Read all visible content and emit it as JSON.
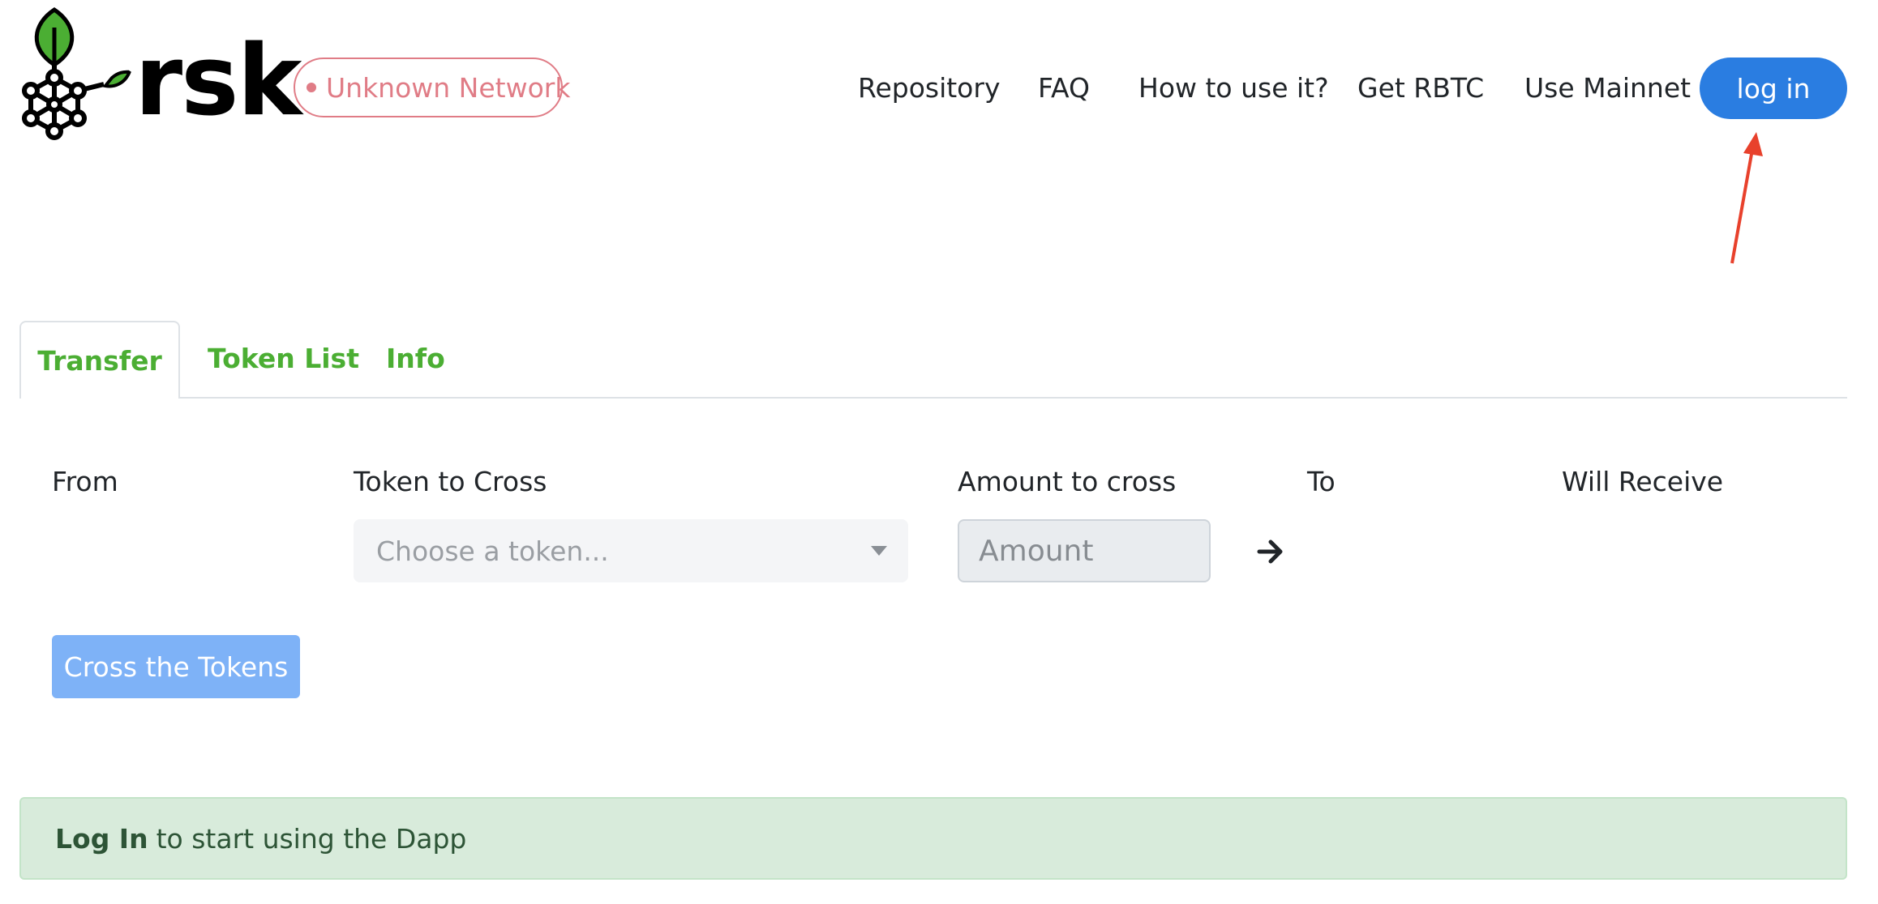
{
  "header": {
    "logo_text": "rsk",
    "network_badge": "Unknown Network",
    "nav": {
      "repository": "Repository",
      "faq": "FAQ",
      "how_to": "How to use it?",
      "get_rbtc": "Get RBTC",
      "use_mainnet": "Use Mainnet"
    },
    "login_label": "log in"
  },
  "tabs": {
    "transfer": "Transfer",
    "token_list": "Token List",
    "info": "Info"
  },
  "form": {
    "from_label": "From",
    "token_label": "Token to Cross",
    "token_placeholder": "Choose a token...",
    "amount_label": "Amount to cross",
    "amount_placeholder": "Amount",
    "to_label": "To",
    "receive_label": "Will Receive",
    "submit_label": "Cross the Tokens"
  },
  "alert": {
    "strong": "Log In",
    "text": "to start using the Dapp"
  },
  "colors": {
    "brand_green": "#4bae33",
    "primary_blue": "#2a7de1",
    "disabled_blue": "#7eb2f7",
    "network_red": "#e07c86",
    "alert_green_bg": "#d8ebdb",
    "annotation_red": "#e8412c"
  },
  "icons": {
    "logo": "rsk-tree-network-logo",
    "arrow": "arrow-right-icon",
    "caret": "chevron-down-icon",
    "annotation": "annotation-arrow-icon"
  }
}
